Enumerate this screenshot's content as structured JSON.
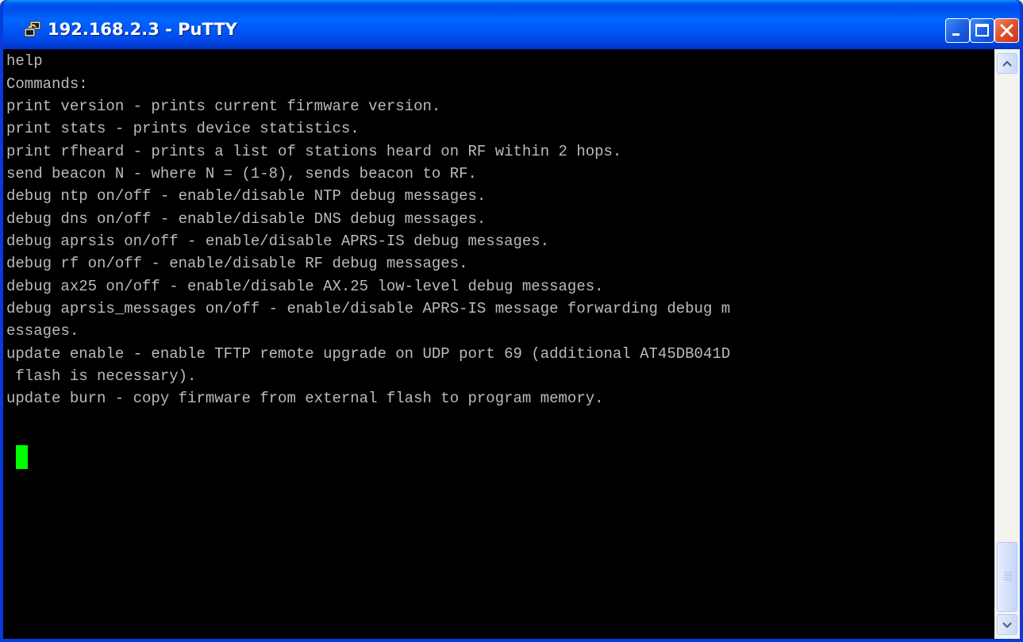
{
  "window": {
    "title": "192.168.2.3 - PuTTY",
    "title_icon": "putty-terminal-icon",
    "controls": {
      "minimize": "minimize-icon",
      "maximize": "maximize-icon",
      "close": "close-icon"
    }
  },
  "colors": {
    "terminal_bg": "#000000",
    "terminal_fg": "#bbbbbb",
    "cursor": "#00ff00",
    "titlebar": "#0058f5"
  },
  "terminal": {
    "lines": [
      "help",
      "Commands:",
      "print version - prints current firmware version.",
      "print stats - prints device statistics.",
      "print rfheard - prints a list of stations heard on RF within 2 hops.",
      "send beacon N - where N = (1-8), sends beacon to RF.",
      "debug ntp on/off - enable/disable NTP debug messages.",
      "debug dns on/off - enable/disable DNS debug messages.",
      "debug aprsis on/off - enable/disable APRS-IS debug messages.",
      "debug rf on/off - enable/disable RF debug messages.",
      "debug ax25 on/off - enable/disable AX.25 low-level debug messages.",
      "debug aprsis_messages on/off - enable/disable APRS-IS message forwarding debug m",
      "essages.",
      "update enable - enable TFTP remote upgrade on UDP port 69 (additional AT45DB041D",
      " flash is necessary).",
      "update burn - copy firmware from external flash to program memory."
    ]
  },
  "scrollbar": {
    "up_icon": "scroll-up-arrow-icon",
    "down_icon": "scroll-down-arrow-icon",
    "position": 1.0
  }
}
